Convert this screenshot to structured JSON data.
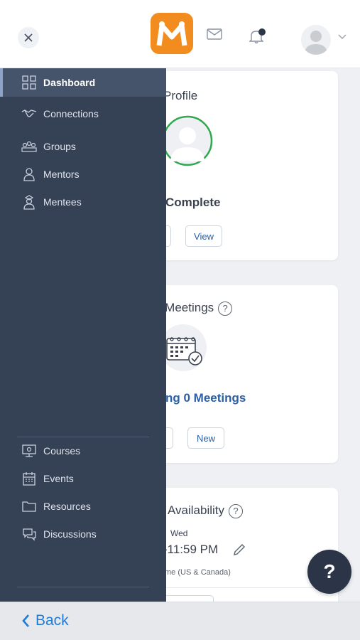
{
  "sidebar": {
    "items": [
      {
        "label": "Dashboard",
        "icon": "dashboard-icon"
      },
      {
        "label": "Connections",
        "icon": "handshake-icon"
      },
      {
        "label": "Groups",
        "icon": "groups-icon"
      },
      {
        "label": "Mentors",
        "icon": "mentor-icon"
      },
      {
        "label": "Mentees",
        "icon": "mentee-icon"
      }
    ],
    "secondary_items": [
      {
        "label": "Courses",
        "icon": "courses-icon"
      },
      {
        "label": "Events",
        "icon": "calendar-icon"
      },
      {
        "label": "Resources",
        "icon": "folder-icon"
      },
      {
        "label": "Discussions",
        "icon": "discussion-icon"
      }
    ]
  },
  "header": {
    "logo_letter": "M",
    "icons": [
      "close-icon",
      "mail-icon",
      "bell-icon",
      "avatar",
      "chevron-down-icon"
    ]
  },
  "cards": {
    "profile": {
      "title": "Profile",
      "status": "Complete",
      "button_label": "View"
    },
    "meetings": {
      "title": "e Meetings",
      "count_text": "ng 0 Meetings",
      "button_label": "New"
    },
    "availability": {
      "title": "Availability",
      "day": "Wed",
      "time": "-11:59 PM",
      "timezone": "me (US & Canada)"
    }
  },
  "footer": {
    "back_label": "Back"
  },
  "help_fab": {
    "label": "?"
  },
  "colors": {
    "sidebar": "#354155",
    "accent_blue": "#2a5fa5",
    "logo": "#f28c1e",
    "ring": "#2fa84f"
  }
}
